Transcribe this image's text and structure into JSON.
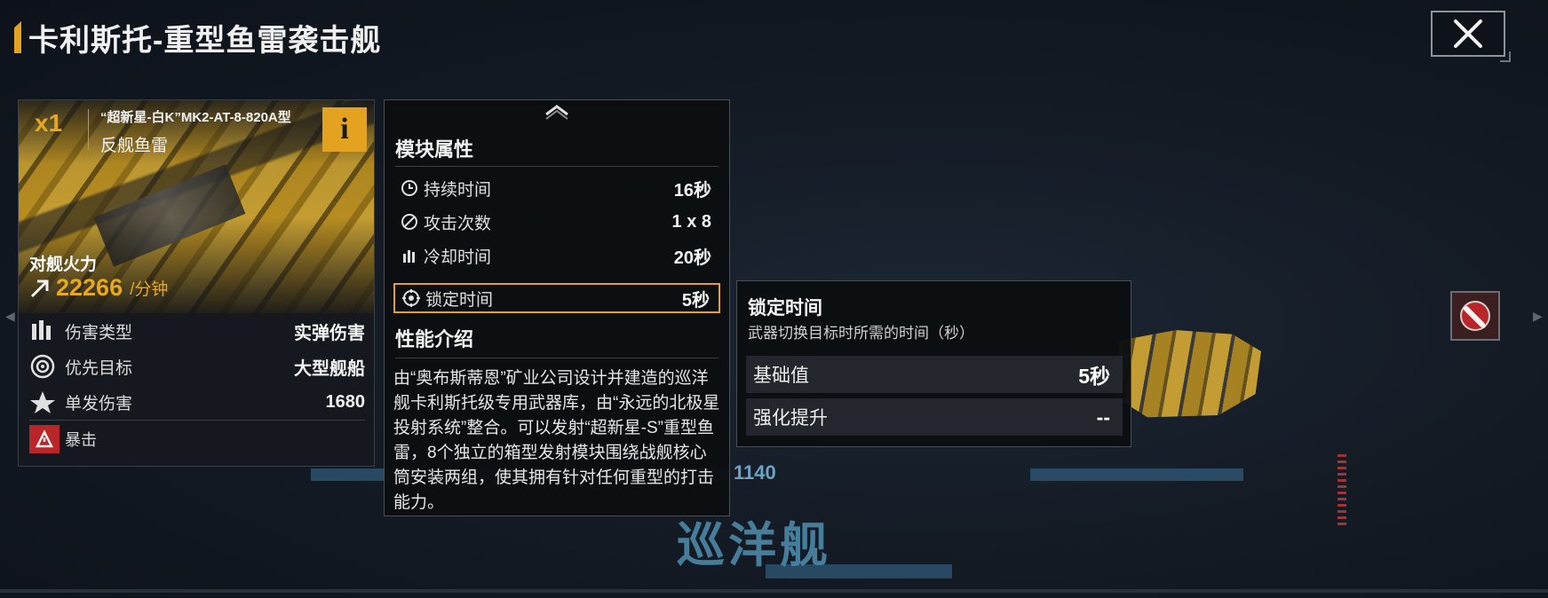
{
  "header": {
    "title": "卡利斯托-重型鱼雷袭击舰",
    "close_icon": "close-icon"
  },
  "weapon_card": {
    "count": "x1",
    "model": "“超新星-白K”MK2-AT-8-820A型",
    "type": "反舰鱼雷",
    "info_label": "i",
    "firepower_label": "对舰火力",
    "firepower_value": "22266",
    "firepower_unit": "/分钟",
    "stats": [
      {
        "label": "伤害类型",
        "value": "实弹伤害",
        "icon": "damage-type-icon"
      },
      {
        "label": "优先目标",
        "value": "大型舰船",
        "icon": "target-icon"
      },
      {
        "label": "单发伤害",
        "value": "1680",
        "icon": "single-damage-icon"
      }
    ],
    "crit_label": "暴击"
  },
  "module_panel": {
    "attr_heading": "模块属性",
    "attributes": [
      {
        "label": "持续时间",
        "value": "16秒",
        "icon": "clock-icon"
      },
      {
        "label": "攻击次数",
        "value": "1 x 8",
        "icon": "attack-count-icon"
      },
      {
        "label": "冷却时间",
        "value": "20秒",
        "icon": "cooldown-icon"
      },
      {
        "label": "锁定时间",
        "value": "5秒",
        "icon": "lock-on-icon"
      }
    ],
    "perf_heading": "性能介绍",
    "description": "由“奥布斯蒂恩”矿业公司设计并建造的巡洋舰卡利斯托级专用武器库，由“永远的北极星投射系统”整合。可以发射“超新星-S”重型鱼雷，8个独立的箱型发射模块围绕战舰核心筒安装两组，使其拥有针对任何重型的打击能力。"
  },
  "tooltip": {
    "title": "锁定时间",
    "description": "武器切换目标时所需的时间（秒）",
    "rows": [
      {
        "label": "基础值",
        "value": "5秒"
      },
      {
        "label": "强化提升",
        "value": "--"
      }
    ]
  },
  "background": {
    "hull_number": "1140",
    "ship_class": "巡洋舰"
  },
  "colors": {
    "accent": "#e3a321",
    "crit": "#b8262a",
    "panel_bg": "#0c0e12"
  }
}
